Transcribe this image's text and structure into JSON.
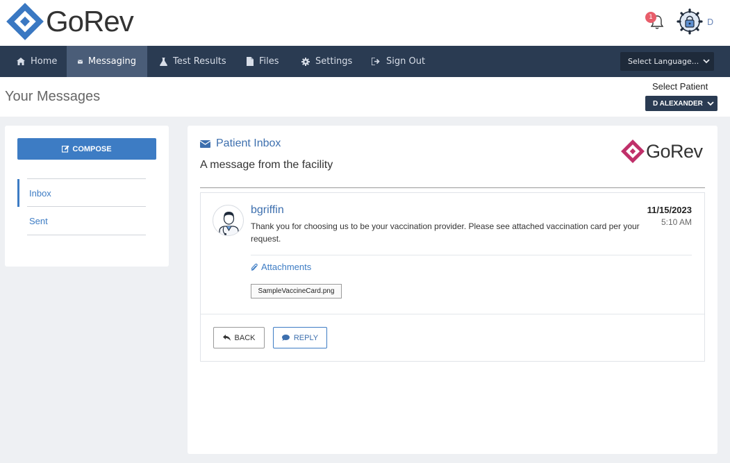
{
  "header": {
    "brand": "GoRev",
    "notification_count": "1",
    "user_initial": "D"
  },
  "nav": {
    "items": [
      {
        "label": "Home",
        "icon": "home-icon"
      },
      {
        "label": "Messaging",
        "icon": "envelope-icon",
        "active": true
      },
      {
        "label": "Test Results",
        "icon": "flask-icon"
      },
      {
        "label": "Files",
        "icon": "file-icon"
      },
      {
        "label": "Settings",
        "icon": "gear-icon"
      },
      {
        "label": "Sign Out",
        "icon": "sign-out-icon"
      }
    ],
    "language_select": "Select Language..."
  },
  "subheader": {
    "title": "Your Messages",
    "select_patient_label": "Select Patient",
    "patient_selected": "D ALEXANDER"
  },
  "sidebar": {
    "compose_label": "COMPOSE",
    "folders": [
      {
        "label": "Inbox",
        "active": true
      },
      {
        "label": "Sent"
      }
    ]
  },
  "inbox": {
    "title": "Patient Inbox",
    "subtitle": "A message from the facility",
    "facility_brand": "GoRev"
  },
  "message": {
    "sender": "bgriffin",
    "date": "11/15/2023",
    "time": "5:10 AM",
    "body": "Thank you for choosing us to be your vaccination provider. Please see attached vaccination card per your request.",
    "attachments_label": "Attachments",
    "attachment_file": "SampleVaccineCard.png"
  },
  "actions": {
    "back_label": "BACK",
    "reply_label": "REPLY"
  },
  "colors": {
    "nav_bg": "#2a3b52",
    "accent": "#3d7cc4",
    "badge": "#e85d6a",
    "logo_blue": "#3a78c2",
    "facility_logo_magenta": "#c0306a"
  }
}
